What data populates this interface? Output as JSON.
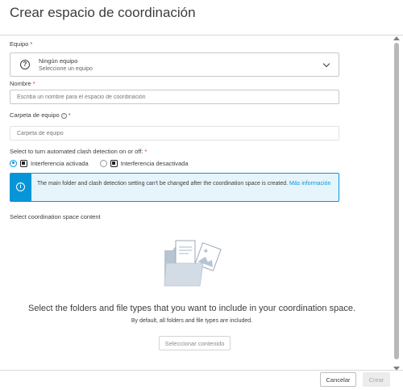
{
  "dialog": {
    "title": "Crear espacio de coordinación"
  },
  "team": {
    "label": "Equipo",
    "required_mark": "*",
    "primary": "Ningún equipo",
    "secondary": "Seleccione un equipo"
  },
  "name": {
    "label": "Nombre",
    "required_mark": "*",
    "placeholder": "Escriba un nombre para el espacio de coordinación"
  },
  "folder": {
    "label": "Carpeta de equipo",
    "info_glyph": "i",
    "required_mark": "*",
    "placeholder": "Carpeta de equipo"
  },
  "clash": {
    "label": "Select to turn automated clash detection on or off:",
    "required_mark": "*",
    "option_on": "Interferencia activada",
    "option_off": "Interferencia desactivada",
    "selected": "on"
  },
  "banner": {
    "text": "The main folder and clash detection setting can't be changed after the coordination space is created.",
    "link": "Más información",
    "accent_color": "#0696d7"
  },
  "content_section": {
    "label": "Select coordination space content",
    "empty_title": "Select the folders and file types that you want to include in your coordination space.",
    "empty_subtitle": "By default, all folders and file types are included.",
    "select_button": "Seleccionar contenido"
  },
  "footer": {
    "cancel": "Cancelar",
    "create": "Crear"
  },
  "icons": {
    "team": "help-circle-icon",
    "dropdown": "chevron-down-icon",
    "info": "info-icon",
    "clash": "clash-icon"
  }
}
